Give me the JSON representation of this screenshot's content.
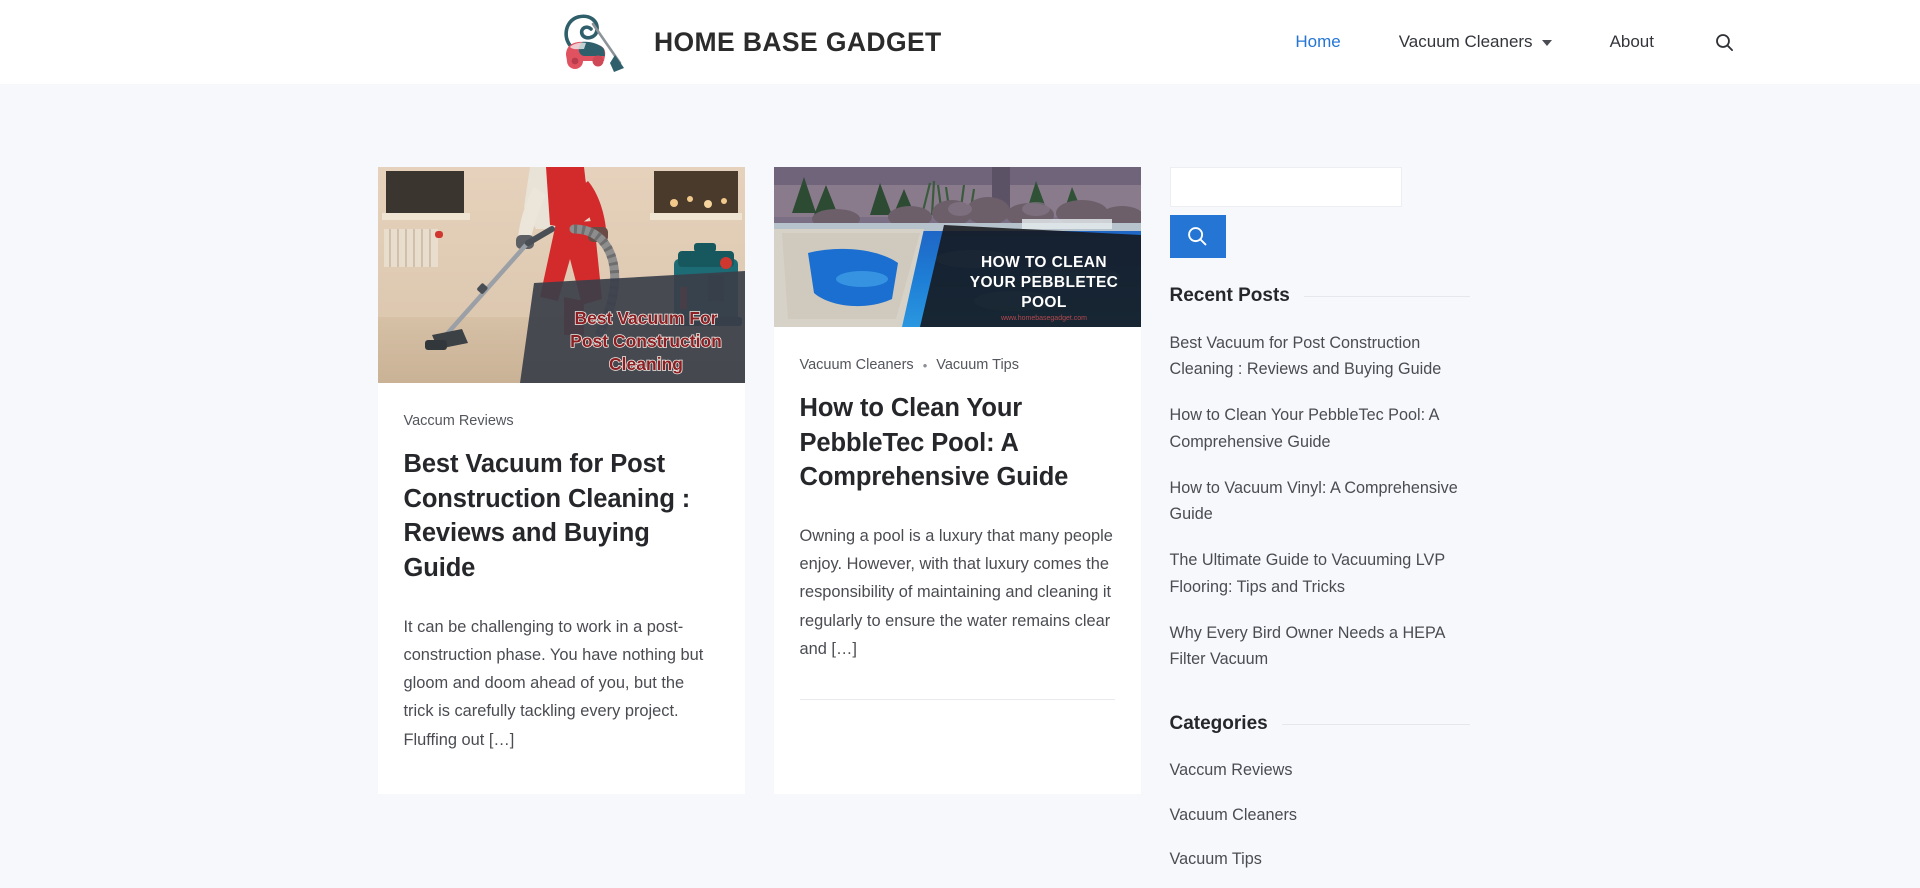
{
  "header": {
    "brand_title": "HOME BASE GADGET",
    "logo_icon": "vacuum-cleaner-logo",
    "nav": [
      {
        "label": "Home",
        "active": true,
        "has_dropdown": false
      },
      {
        "label": "Vacuum Cleaners",
        "active": false,
        "has_dropdown": true
      },
      {
        "label": "About",
        "active": false,
        "has_dropdown": false
      }
    ],
    "search_icon": "search-icon"
  },
  "posts": [
    {
      "thumb_overlay_lines": [
        "Best Vacuum For",
        "Post Construction",
        "Cleaning"
      ],
      "categories": [
        "Vaccum Reviews"
      ],
      "title": "Best Vacuum for Post Construction Cleaning : Reviews and Buying Guide",
      "excerpt": "It can be challenging to work in a post-construction phase. You have nothing but gloom and doom ahead of you, but the trick is carefully tackling every project. Fluffing out […]"
    },
    {
      "thumb_overlay_lines": [
        "HOW TO CLEAN",
        "YOUR PEBBLETEC",
        "POOL"
      ],
      "thumb_watermark": "www.homebasegadget.com",
      "categories": [
        "Vacuum Cleaners",
        "Vacuum Tips"
      ],
      "category_separator": "•",
      "title": "How to Clean Your PebbleTec Pool: A Comprehensive Guide",
      "excerpt": "Owning a pool is a luxury that many people enjoy. However, with that luxury comes the responsibility of maintaining and cleaning it regularly to ensure the water remains clear and […]"
    }
  ],
  "sidebar": {
    "search": {
      "value": "",
      "placeholder": "",
      "button_icon": "search-icon"
    },
    "recent_posts": {
      "heading": "Recent Posts",
      "items": [
        "Best Vacuum for Post Construction Cleaning : Reviews and Buying Guide",
        "How to Clean Your PebbleTec Pool: A Comprehensive Guide",
        "How to Vacuum Vinyl: A Comprehensive Guide",
        "The Ultimate Guide to Vacuuming LVP Flooring: Tips and Tricks",
        "Why Every Bird Owner Needs a HEPA Filter Vacuum"
      ]
    },
    "categories": {
      "heading": "Categories",
      "items": [
        "Vaccum Reviews",
        "Vacuum Cleaners",
        "Vacuum Tips"
      ]
    }
  },
  "colors": {
    "accent_blue": "#2475d4",
    "page_background": "#f6f8fc",
    "card_background": "#ffffff",
    "text_dark": "#26272b",
    "text_body": "#4a4c52"
  }
}
